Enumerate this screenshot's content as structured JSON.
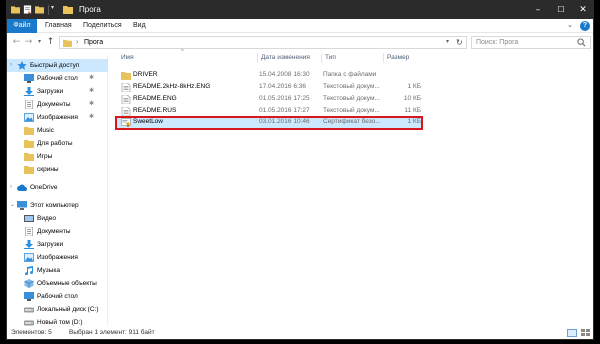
{
  "window": {
    "title": "Прога"
  },
  "ribbon": {
    "tabs": [
      "Файл",
      "Главная",
      "Поделиться",
      "Вид"
    ]
  },
  "navbar": {
    "path_segment": "Прога",
    "search_placeholder": "Поиск: Прога"
  },
  "sidebar": {
    "items": [
      {
        "label": "Быстрый доступ",
        "icon": "star-icon",
        "pinned": false
      },
      {
        "label": "Рабочий стол",
        "icon": "desktop-icon",
        "pinned": true
      },
      {
        "label": "Загрузки",
        "icon": "download-icon",
        "pinned": true
      },
      {
        "label": "Документы",
        "icon": "documents-icon",
        "pinned": true
      },
      {
        "label": "Изображения",
        "icon": "pictures-icon",
        "pinned": true
      },
      {
        "label": "Music",
        "icon": "folder-icon",
        "pinned": false
      },
      {
        "label": "Для работы",
        "icon": "folder-icon",
        "pinned": false
      },
      {
        "label": "Игры",
        "icon": "folder-icon",
        "pinned": false
      },
      {
        "label": "скрины",
        "icon": "folder-icon",
        "pinned": false
      },
      {
        "label": "OneDrive",
        "icon": "cloud-icon",
        "pinned": false
      },
      {
        "label": "Этот компьютер",
        "icon": "computer-icon",
        "pinned": false
      },
      {
        "label": "Видео",
        "icon": "video-icon",
        "pinned": false
      },
      {
        "label": "Документы",
        "icon": "documents-icon",
        "pinned": false
      },
      {
        "label": "Загрузки",
        "icon": "download-icon",
        "pinned": false
      },
      {
        "label": "Изображения",
        "icon": "pictures-icon",
        "pinned": false
      },
      {
        "label": "Музыка",
        "icon": "music-icon",
        "pinned": false
      },
      {
        "label": "Объемные объекты",
        "icon": "3d-objects-icon",
        "pinned": false
      },
      {
        "label": "Рабочий стол",
        "icon": "desktop-icon",
        "pinned": false
      },
      {
        "label": "Локальный диск (C:)",
        "icon": "drive-icon",
        "pinned": false
      },
      {
        "label": "Новый том (D:)",
        "icon": "drive-icon",
        "pinned": false
      }
    ]
  },
  "columns": {
    "name": "Имя",
    "date": "Дата изменения",
    "type": "Тип",
    "size": "Размер"
  },
  "files": [
    {
      "name": "DRIVER",
      "date": "15.04.2008 16:30",
      "type": "Папка с файлами",
      "size": "",
      "icon": "folder-icon"
    },
    {
      "name": "README.2kHz-8kHz.ENG",
      "date": "17.04.2016 6:36",
      "type": "Текстовый докум...",
      "size": "1 КБ",
      "icon": "text-file-icon"
    },
    {
      "name": "README.ENG",
      "date": "01.05.2016 17:25",
      "type": "Текстовый докум...",
      "size": "10 КБ",
      "icon": "text-file-icon"
    },
    {
      "name": "README.RUS",
      "date": "01.05.2016 17:27",
      "type": "Текстовый докум...",
      "size": "11 КБ",
      "icon": "text-file-icon"
    },
    {
      "name": "SweetLow",
      "date": "03.01.2016 10:46",
      "type": "Сертификат безо...",
      "size": "1 КБ",
      "icon": "certificate-icon",
      "selected": true
    }
  ],
  "status": {
    "items_count": "Элементов: 5",
    "selection": "Выбран 1 элемент: 911 байт"
  },
  "colors": {
    "accent": "#1979ca",
    "selection": "#cce8ff",
    "highlight_border": "#d6171d",
    "folder": "#e8c25a"
  }
}
